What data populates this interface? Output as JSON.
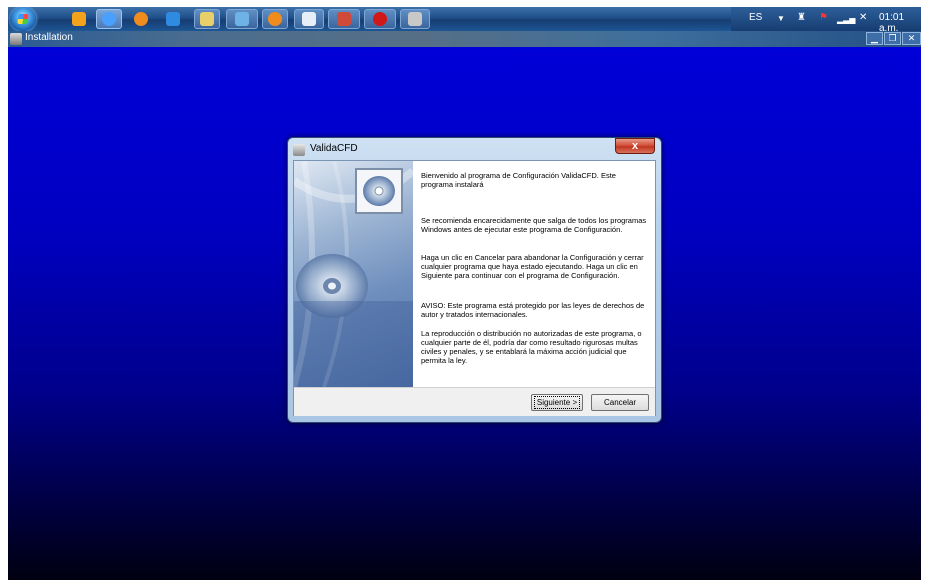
{
  "taskbar": {
    "tray": {
      "language": "ES",
      "time": "01:01 a.m."
    }
  },
  "window": {
    "title": "Installation"
  },
  "dialog": {
    "title": "ValidaCFD",
    "close_glyph": "x",
    "paragraphs": [
      "Bienvenido al programa de Configuración ValidaCFD. Este programa instalará",
      "Se recomienda encarecidamente que salga de todos los programas Windows antes de ejecutar este programa de Configuración.",
      "Haga un clic en Cancelar para abandonar la Configuración y cerrar cualquier programa que haya estado ejecutando. Haga un clic en Siguiente para continuar con el programa de Configuración.",
      "AVISO: Este programa está protegido por las leyes de derechos de autor y tratados internacionales.",
      "La reproducción o distribución no autorizadas de este programa, o cualquier parte de él, podría dar como resultado rigurosas multas civiles y penales, y se entablará la máxima acción judicial que permita la ley."
    ],
    "buttons": {
      "next": "Siguiente >",
      "cancel": "Cancelar"
    }
  },
  "colors": {
    "install_background_top": "#0000d8",
    "install_background_bottom": "#000010",
    "close_button": "#c03620"
  }
}
